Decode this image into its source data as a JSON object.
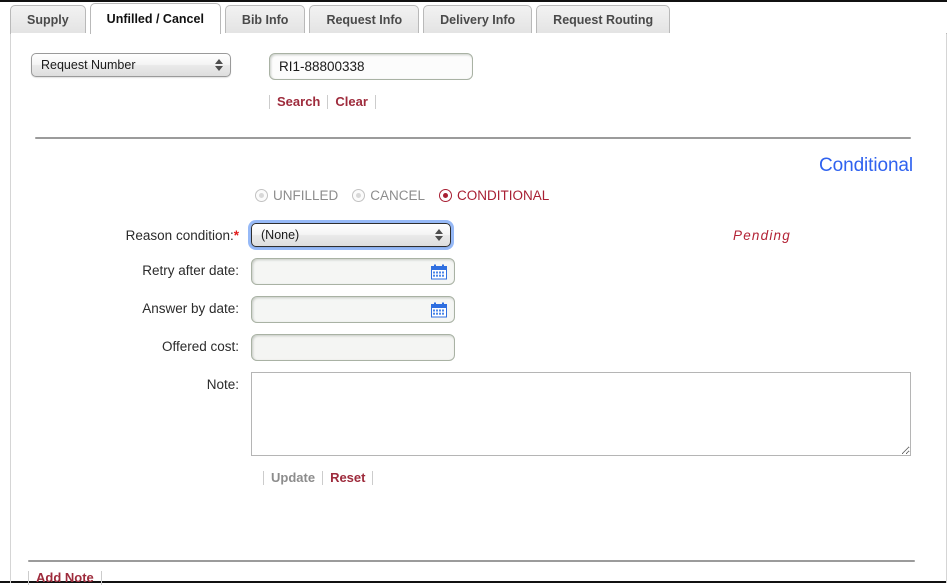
{
  "tabs": [
    {
      "label": "Supply",
      "active": false
    },
    {
      "label": "Unfilled / Cancel",
      "active": true
    },
    {
      "label": "Bib Info",
      "active": false
    },
    {
      "label": "Request Info",
      "active": false
    },
    {
      "label": "Delivery Info",
      "active": false
    },
    {
      "label": "Request Routing",
      "active": false
    }
  ],
  "search": {
    "field_selector_value": "Request Number",
    "query_value": "RI1-88800338",
    "query_placeholder": "",
    "search_label": "Search",
    "clear_label": "Clear"
  },
  "panel": {
    "heading": "Conditional",
    "heading_color": "#2f62ef",
    "status_text": "Pending",
    "status_color": "#b32336"
  },
  "mode_options": [
    {
      "label": "UNFILLED",
      "checked": false
    },
    {
      "label": "CANCEL",
      "checked": false
    },
    {
      "label": "CONDITIONAL",
      "checked": true
    }
  ],
  "form": {
    "reason_condition": {
      "label": "Reason condition:",
      "required_marker": "*",
      "value": "(None)"
    },
    "retry_after_date": {
      "label": "Retry after date:",
      "value": "",
      "placeholder": ""
    },
    "answer_by_date": {
      "label": "Answer by date:",
      "value": "",
      "placeholder": ""
    },
    "offered_cost": {
      "label": "Offered cost:",
      "value": "",
      "placeholder": ""
    },
    "note": {
      "label": "Note:",
      "value": "",
      "placeholder": ""
    },
    "update_label": "Update",
    "reset_label": "Reset"
  },
  "footer": {
    "add_note_label": "Add Note"
  },
  "icons": {
    "calendar": "calendar-icon",
    "select_caret": "updown-caret-icon",
    "resize_handle": "resize-handle-icon"
  },
  "colors": {
    "link": "#9e2b3c",
    "muted_link": "#8c8c8c",
    "accent_blue": "#2f62ef",
    "required": "#e11b1b",
    "selected_radio": "#a81f33"
  }
}
